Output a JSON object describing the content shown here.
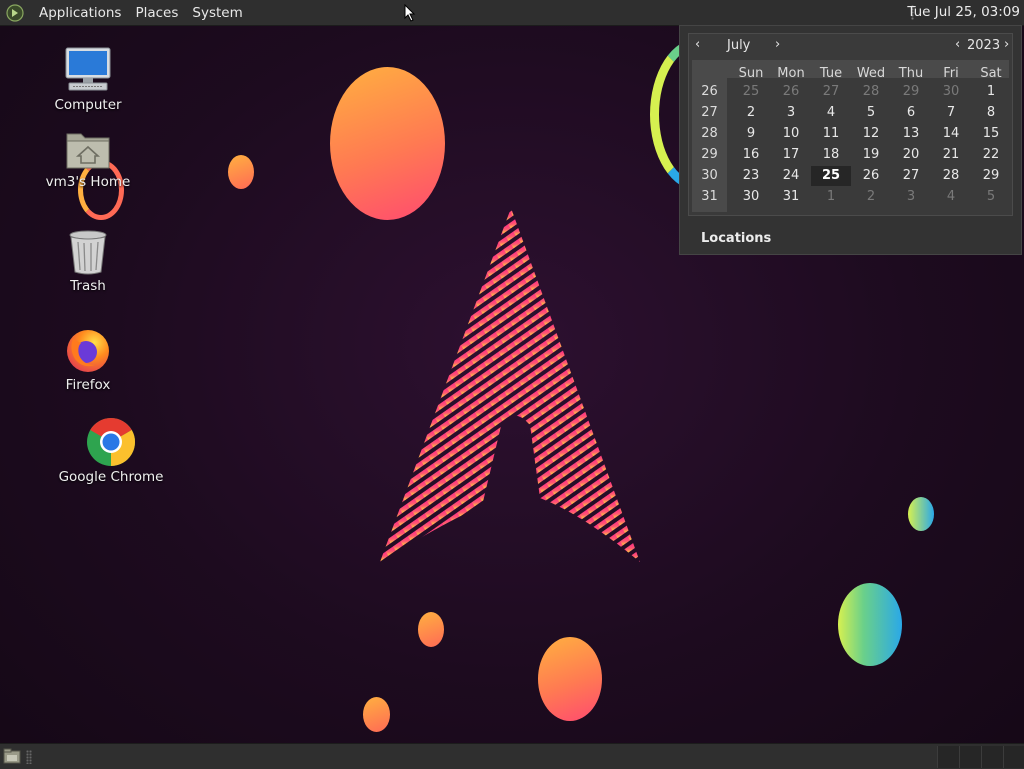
{
  "top_panel": {
    "menus": [
      "Applications",
      "Places",
      "System"
    ],
    "clock": "Tue Jul 25, 03:09",
    "logo_icon": "mate-menu-icon"
  },
  "desktop": {
    "icons": [
      {
        "label": "Computer",
        "icon": "computer-icon"
      },
      {
        "label": "vm3's Home",
        "icon": "home-folder-icon"
      },
      {
        "label": "Trash",
        "icon": "trash-icon"
      },
      {
        "label": "Firefox",
        "icon": "firefox-icon"
      },
      {
        "label": "Google Chrome",
        "icon": "chrome-icon"
      }
    ],
    "wallpaper_colors": {
      "background": "#1d0b1f",
      "accent": "#ff3c78",
      "warm": "#ffa64a",
      "cool": "#2aa8e8"
    }
  },
  "calendar": {
    "month": "July",
    "year": "2023",
    "prev_month": "‹",
    "next_month": "›",
    "prev_year": "‹",
    "next_year": "›",
    "weekdays": [
      "Sun",
      "Mon",
      "Tue",
      "Wed",
      "Thu",
      "Fri",
      "Sat"
    ],
    "week_numbers": [
      "26",
      "27",
      "28",
      "29",
      "30",
      "31"
    ],
    "weeks": [
      [
        "25",
        "26",
        "27",
        "28",
        "29",
        "30",
        "1"
      ],
      [
        "2",
        "3",
        "4",
        "5",
        "6",
        "7",
        "8"
      ],
      [
        "9",
        "10",
        "11",
        "12",
        "13",
        "14",
        "15"
      ],
      [
        "16",
        "17",
        "18",
        "19",
        "20",
        "21",
        "22"
      ],
      [
        "23",
        "24",
        "25",
        "26",
        "27",
        "28",
        "29"
      ],
      [
        "30",
        "31",
        "1",
        "2",
        "3",
        "4",
        "5"
      ]
    ],
    "today": "25",
    "locations_label": "Locations"
  }
}
